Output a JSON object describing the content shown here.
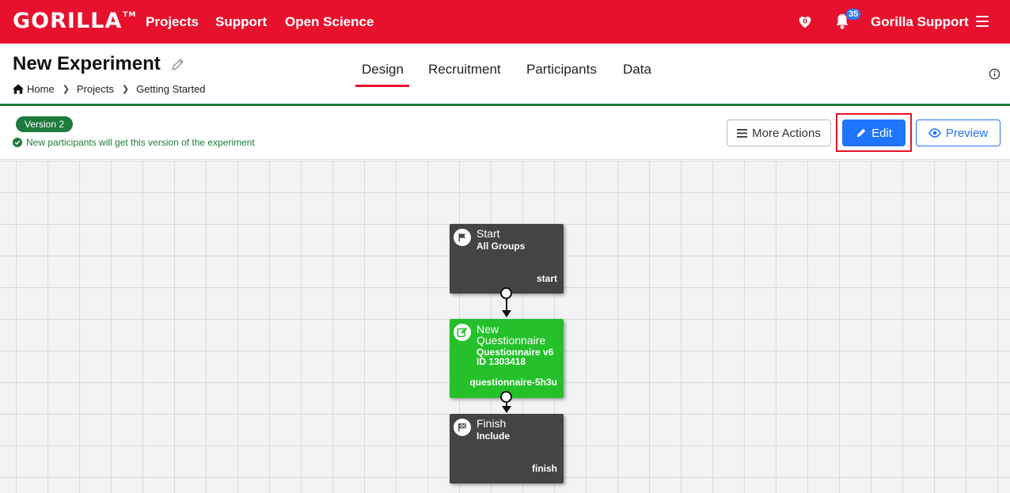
{
  "nav": {
    "logo": "GORILLA",
    "logo_tm": "TM",
    "links": [
      "Projects",
      "Support",
      "Open Science"
    ],
    "heart_count": "0",
    "notifications_count": "35",
    "user_name": "Gorilla Support"
  },
  "header": {
    "title": "New Experiment",
    "breadcrumb": [
      "Home",
      "Projects",
      "Getting Started"
    ],
    "tabs": [
      "Design",
      "Recruitment",
      "Participants",
      "Data"
    ],
    "active_tab": "Design"
  },
  "version": {
    "badge": "Version 2",
    "note": "New participants will get this version of the experiment"
  },
  "actions": {
    "more_label": "More Actions",
    "edit_label": "Edit",
    "preview_label": "Preview"
  },
  "nodes": [
    {
      "title": "Start",
      "subtitle": "All Groups",
      "key": "start",
      "icon": "flag-icon"
    },
    {
      "title": "New\nQuestionnaire",
      "title_line1": "New",
      "title_line2": "Questionnaire",
      "subtitle1": "Questionnaire v6",
      "subtitle2": "ID 1303418",
      "key": "questionnaire-5h3u",
      "icon": "edit-square-icon"
    },
    {
      "title": "Finish",
      "subtitle": "Include",
      "key": "finish",
      "icon": "checkered-flag-icon"
    }
  ],
  "colors": {
    "brand": "#e8112d",
    "accent_green": "#1e7b3c",
    "node_green": "#25c12b",
    "node_dark": "#444444",
    "primary_blue": "#1f75ff"
  }
}
